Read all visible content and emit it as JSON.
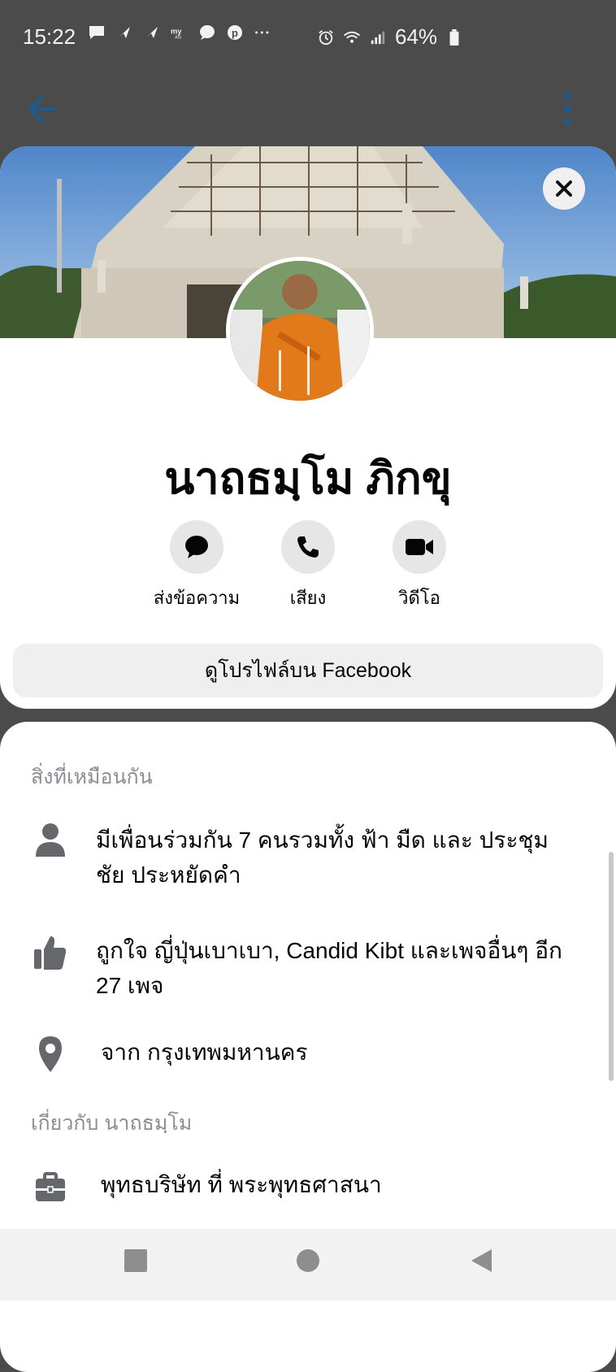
{
  "status_bar": {
    "time": "15:22",
    "battery": "64%"
  },
  "profile": {
    "name": "นาถธมฺโม ภิกขุ",
    "actions": {
      "message": "ส่งข้อความ",
      "voice": "เสียง",
      "video": "วิดีโอ"
    },
    "view_profile": "ดูโปรไฟล์บน Facebook"
  },
  "info": {
    "common_title": "สิ่งที่เหมือนกัน",
    "mutual_friends": "มีเพื่อนร่วมกัน 7 คนรวมทั้ง ฟ้า มืด และ ประชุม ชัย ประหยัดคำ",
    "likes": "ถูกใจ ญี่ปุ่นเบาเบา, Candid Kibt และเพจอื่นๆ อีก 27 เพจ",
    "location": "จาก กรุงเทพมหานคร",
    "about_title": "เกี่ยวกับ นาถธมฺโม",
    "work": "พุทธบริษัท ที่ พระพุทธศาสนา"
  }
}
